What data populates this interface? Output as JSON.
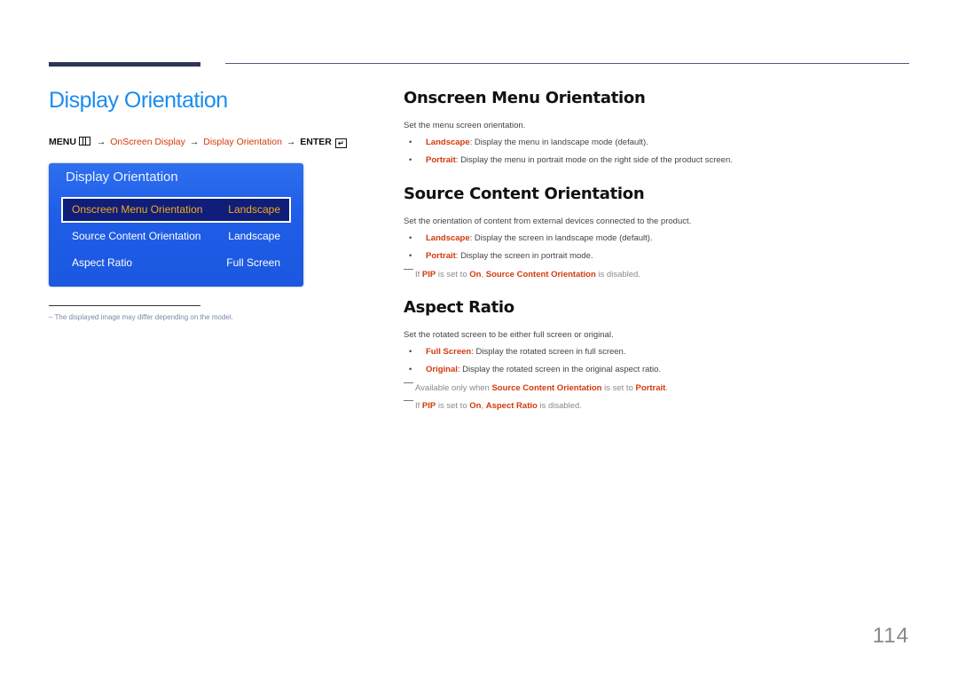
{
  "header": {
    "title": "Display Orientation"
  },
  "menu_path": {
    "menu": "MENU",
    "menu_icon": "menu-grid-icon",
    "arrow": "→",
    "step1": "OnScreen Display",
    "step2": "Display Orientation",
    "enter": "ENTER",
    "enter_icon": "enter-icon"
  },
  "osd": {
    "title": "Display Orientation",
    "rows": [
      {
        "label": "Onscreen Menu Orientation",
        "value": "Landscape",
        "selected": true
      },
      {
        "label": "Source Content Orientation",
        "value": "Landscape",
        "selected": false
      },
      {
        "label": "Aspect Ratio",
        "value": "Full Screen",
        "selected": false
      }
    ]
  },
  "footnote": {
    "dash": "–",
    "text": "The displayed image may differ depending on the model."
  },
  "sections": {
    "onscreen": {
      "heading": "Onscreen Menu Orientation",
      "desc": "Set the menu screen orientation.",
      "bullets": [
        {
          "term": "Landscape",
          "text": ": Display the menu in landscape mode (default)."
        },
        {
          "term": "Portrait",
          "text": ": Display the menu in portrait mode on the right side of the product screen."
        }
      ]
    },
    "source": {
      "heading": "Source Content Orientation",
      "desc": "Set the orientation of content from external devices connected to the product.",
      "bullets": [
        {
          "term": "Landscape",
          "text": ": Display the screen in landscape mode (default)."
        },
        {
          "term": "Portrait",
          "text": ": Display the screen in portrait mode."
        }
      ],
      "note": {
        "pre": "If ",
        "t1": "PIP",
        "mid1": " is set to ",
        "t2": "On",
        "mid2": ", ",
        "t3": "Source Content Orientation",
        "post": " is disabled."
      }
    },
    "aspect": {
      "heading": "Aspect Ratio",
      "desc": "Set the rotated screen to be either full screen or original.",
      "bullets": [
        {
          "term": "Full Screen",
          "text": ": Display the rotated screen in full screen."
        },
        {
          "term": "Original",
          "text": ": Display the rotated screen in the original aspect ratio."
        }
      ],
      "note1": {
        "pre": "Available only when ",
        "t1": "Source Content Orientation",
        "mid": " is set to ",
        "t2": "Portrait",
        "post": "."
      },
      "note2": {
        "pre": "If ",
        "t1": "PIP",
        "mid1": " is set to ",
        "t2": "On",
        "mid2": ", ",
        "t3": "Aspect Ratio",
        "post": " is disabled."
      }
    }
  },
  "bullet_char": "•",
  "page_number": "114"
}
